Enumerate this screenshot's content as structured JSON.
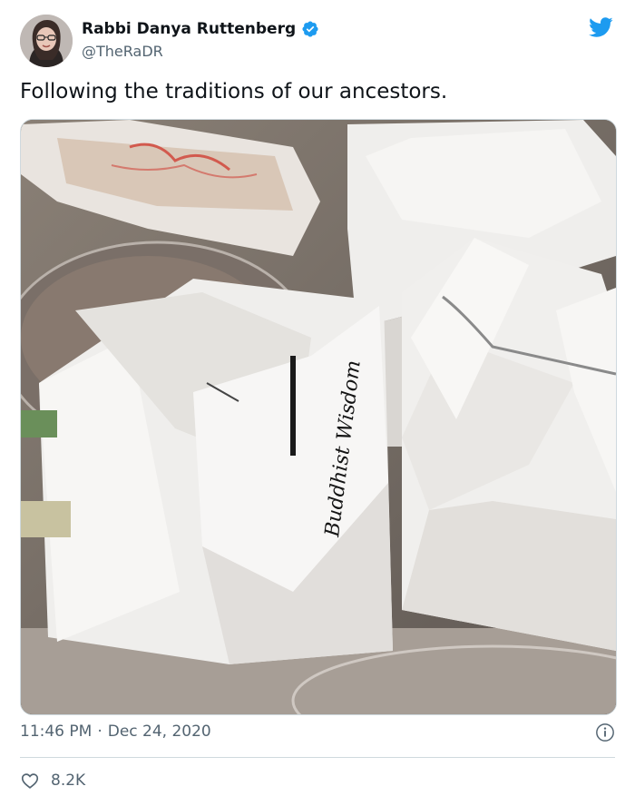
{
  "author": {
    "name": "Rabbi Danya Ruttenberg",
    "handle": "@TheRaDR"
  },
  "tweet": {
    "text": "Following the traditions of our ancestors.",
    "time": "11:46 PM",
    "separator": "·",
    "date": "Dec 24, 2020",
    "likes": "8.2K"
  },
  "photo": {
    "box_label": "Buddhist Wisdom"
  },
  "colors": {
    "brand": "#1d9bf0",
    "secondary_text": "#536471",
    "divider": "#cfd9de"
  },
  "icons": [
    "verified-badge-icon",
    "twitter-bird-icon",
    "info-icon",
    "heart-icon"
  ]
}
